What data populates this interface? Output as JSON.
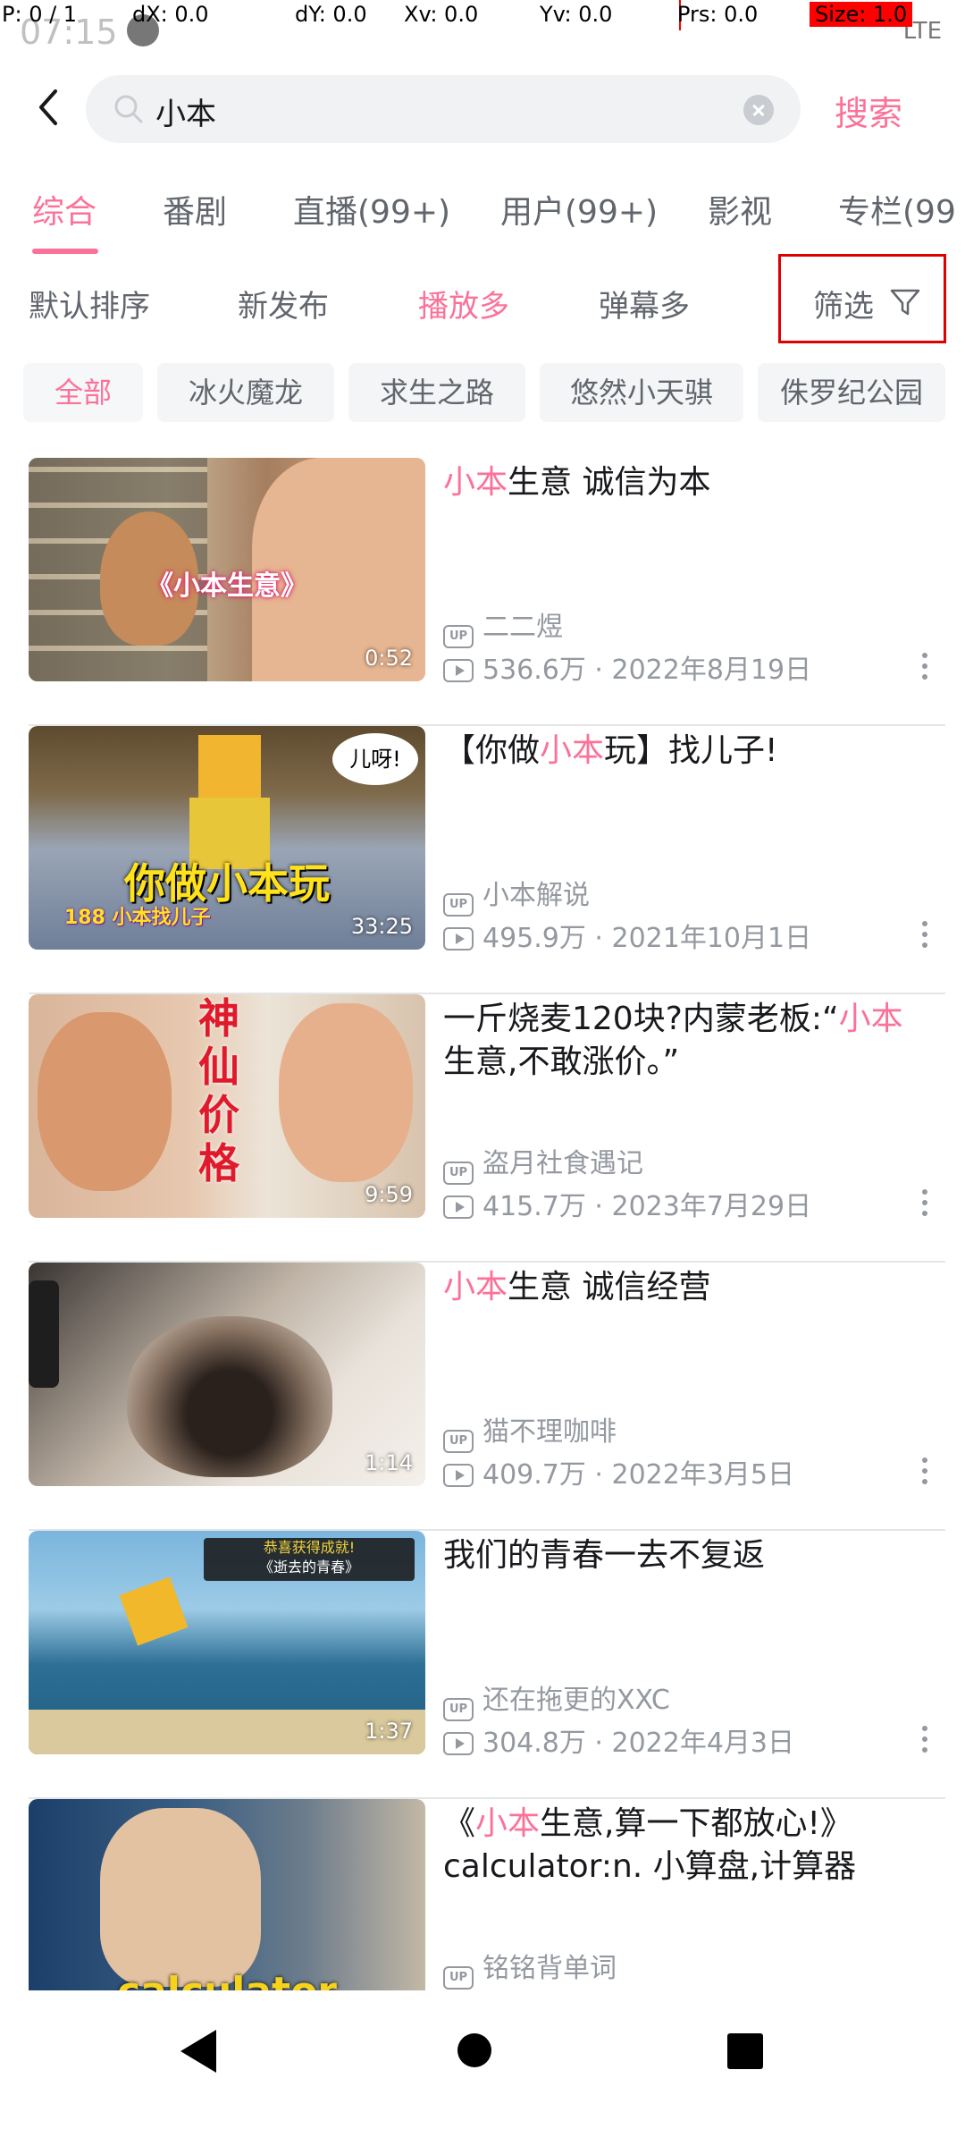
{
  "debug": {
    "p": "P: 0 / 1",
    "dx": "dX: 0.0",
    "dy": "dY: 0.0",
    "xv": "Xv: 0.0",
    "yv": "Yv: 0.0",
    "prs": "Prs: 0.0",
    "size": "Size: 1.0"
  },
  "status": {
    "time": "07:15",
    "network": "LTE"
  },
  "search": {
    "query": "小本",
    "button_label": "搜索"
  },
  "tabs": [
    {
      "label": "综合"
    },
    {
      "label": "番剧"
    },
    {
      "label": "直播(99+)"
    },
    {
      "label": "用户(99+)"
    },
    {
      "label": "影视"
    },
    {
      "label": "专栏(99"
    }
  ],
  "sort": {
    "items": [
      {
        "label": "默认排序"
      },
      {
        "label": "新发布"
      },
      {
        "label": "播放多"
      },
      {
        "label": "弹幕多"
      }
    ],
    "filter_label": "筛选"
  },
  "chips": [
    {
      "label": "全部"
    },
    {
      "label": "冰火魔龙"
    },
    {
      "label": "求生之路"
    },
    {
      "label": "悠然小天骐"
    },
    {
      "label": "侏罗纪公园"
    }
  ],
  "videos": [
    {
      "title_pre": "",
      "title_hl": "小本",
      "title_post": "生意 诚信为本",
      "uploader": "二二煜",
      "stats": "536.6万 · 2022年8月19日",
      "duration": "0:52",
      "thumb_caption": "《小本生意》"
    },
    {
      "title_pre": "【你做",
      "title_hl": "小本",
      "title_post": "玩】找儿子!",
      "uploader": "小本解说",
      "stats": "495.9万 · 2021年10月1日",
      "duration": "33:25",
      "thumb_caption": "你做小本玩",
      "thumb_sub": "188 小本找儿子",
      "thumb_bubble": "儿呀!"
    },
    {
      "title_pre": "一斤烧麦120块?内蒙老板:“",
      "title_hl": "小本",
      "title_post": "生意,不敢涨价。”",
      "uploader": "盗月社食遇记",
      "stats": "415.7万 · 2023年7月29日",
      "duration": "9:59",
      "thumb_caption": "神仙价格"
    },
    {
      "title_pre": "",
      "title_hl": "小本",
      "title_post": "生意 诚信经营",
      "uploader": "猫不理咖啡",
      "stats": "409.7万 · 2022年3月5日",
      "duration": "1:14"
    },
    {
      "title_pre": "我们的青春一去不复返",
      "title_hl": "",
      "title_post": "",
      "uploader": "还在拖更的XXC",
      "stats": "304.8万 · 2022年4月3日",
      "duration": "1:37",
      "thumb_caption": "恭喜获得成就!",
      "thumb_sub": "《逝去的青春》"
    },
    {
      "title_pre": "《",
      "title_hl": "小本",
      "title_post": "生意,算一下都放心!》calculator:n. 小算盘,计算器",
      "uploader": "铭铭背单词",
      "stats": "",
      "duration": "",
      "thumb_caption": "calculator"
    }
  ],
  "colors": {
    "accent": "#fb7299",
    "text": "#18191c",
    "muted": "#9499a0",
    "highlight_box": "#e00000"
  }
}
